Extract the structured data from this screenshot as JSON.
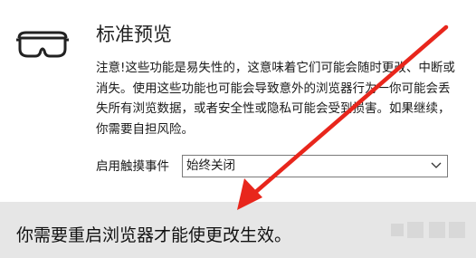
{
  "section": {
    "title": "标准预览",
    "icon": "goggles-icon"
  },
  "warning": {
    "text": "注意!这些功能是易失性的，这意味着它们可能会随时更改、中断或消失。使用这些功能也可能会导致意外的浏览器行为一你可能会丢失所有浏览数据，或者安全性或隐私可能会受到损害。如果继续，你需要自担风险。"
  },
  "touch_events": {
    "label": "启用触摸事件",
    "selected_value": "始终关闭",
    "icon": "chevron-down-icon"
  },
  "restart_banner": {
    "text": "你需要重启浏览器才能使更改生效。"
  },
  "annotation": {
    "color": "#e8261c"
  }
}
